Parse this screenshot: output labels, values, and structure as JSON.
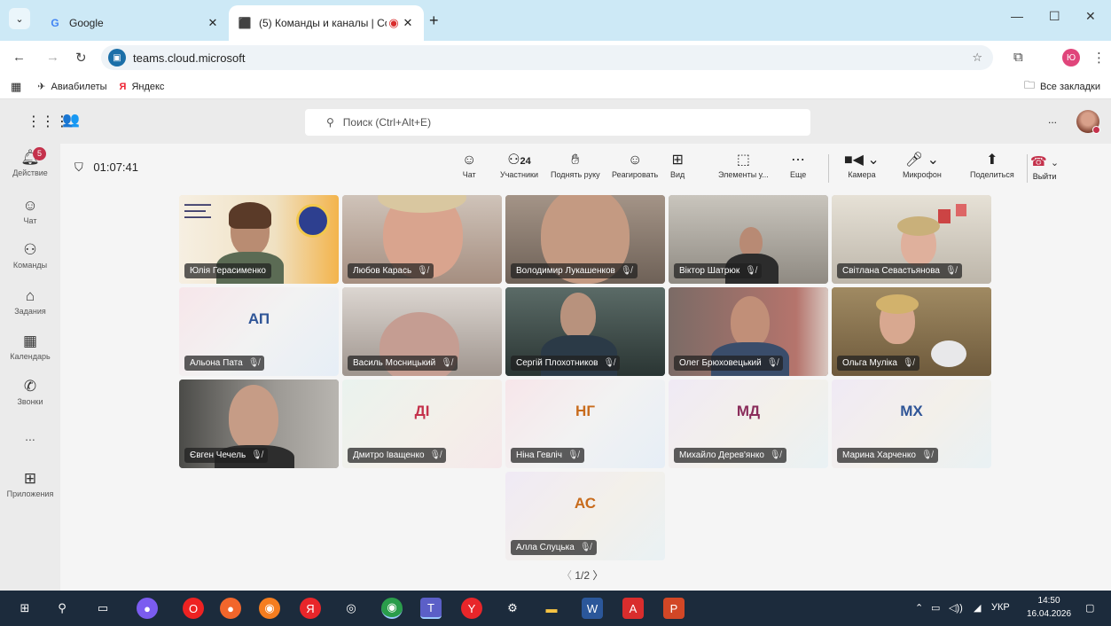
{
  "browser": {
    "tabs": [
      {
        "title": "Google",
        "favicon": "G"
      },
      {
        "title": "(5) Команды и каналы | Co",
        "favicon": "teams"
      }
    ],
    "url": "teams.cloud.microsoft",
    "profile_initial": "Ю",
    "bookmarks": [
      "Авиабилеты",
      "Яндекс"
    ],
    "all_bookmarks": "Все закладки"
  },
  "teams": {
    "search_placeholder": "Поиск (Ctrl+Alt+E)",
    "more": "...",
    "rail": [
      {
        "label": "Действие",
        "icon": "bell-icon",
        "badge": "5"
      },
      {
        "label": "Чат",
        "icon": "chat-icon"
      },
      {
        "label": "Команды",
        "icon": "teams-icon"
      },
      {
        "label": "Задания",
        "icon": "assignments-icon"
      },
      {
        "label": "Календарь",
        "icon": "calendar-icon"
      },
      {
        "label": "Звонки",
        "icon": "phone-icon"
      },
      {
        "label": "...",
        "icon": "more-icon"
      },
      {
        "label": "Приложения",
        "icon": "apps-icon"
      }
    ],
    "meeting": {
      "timer": "01:07:41",
      "participants_count": "24",
      "toolbar": {
        "chat": "Чат",
        "participants": "Участники",
        "raise_hand": "Поднять руку",
        "react": "Реагировать",
        "view": "Вид",
        "elements": "Элементы у...",
        "more": "Еще",
        "camera": "Камера",
        "mic": "Микрофон",
        "share": "Поделиться",
        "leave": "Выйти"
      },
      "participants": [
        {
          "name": "Юлія Герасименко",
          "initials": "",
          "video": true
        },
        {
          "name": "Любов Карась",
          "initials": "",
          "video": true
        },
        {
          "name": "Володимир Лукашенков",
          "initials": "",
          "video": true
        },
        {
          "name": "Віктор Шатрюк",
          "initials": "",
          "video": true
        },
        {
          "name": "Світлана Севастьянова",
          "initials": "",
          "video": true
        },
        {
          "name": "Альона Пата",
          "initials": "АП",
          "video": false
        },
        {
          "name": "Василь Мосницький",
          "initials": "",
          "video": true
        },
        {
          "name": "Сергій Плохотников",
          "initials": "",
          "video": true
        },
        {
          "name": "Олег Брюховецький",
          "initials": "",
          "video": true
        },
        {
          "name": "Ольга Муліка",
          "initials": "",
          "video": true
        },
        {
          "name": "Євген Чечель",
          "initials": "",
          "video": true
        },
        {
          "name": "Дмитро Іващенко",
          "initials": "ДІ",
          "video": false
        },
        {
          "name": "Ніна Гевліч",
          "initials": "НГ",
          "video": false
        },
        {
          "name": "Михайло Дерев'янко",
          "initials": "МД",
          "video": false
        },
        {
          "name": "Марина Харченко",
          "initials": "МХ",
          "video": false
        },
        {
          "name": "Алла Слуцька",
          "initials": "АС",
          "video": false
        }
      ],
      "page": "1/2"
    }
  },
  "taskbar": {
    "language": "УКР",
    "time": "14:50",
    "date": "16.04.2026"
  }
}
